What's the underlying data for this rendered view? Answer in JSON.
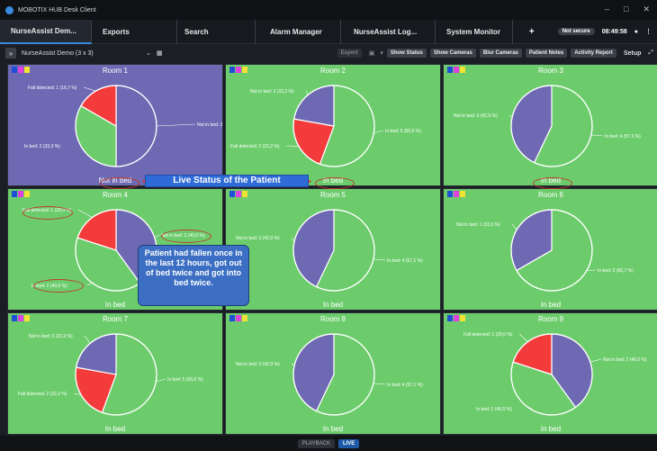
{
  "titlebar": {
    "title": "MOBOTIX HUB Desk Client"
  },
  "tabs": [
    {
      "label": "NurseAssist Dem..."
    },
    {
      "label": "Exports"
    },
    {
      "label": "Search"
    },
    {
      "label": "Alarm Manager"
    },
    {
      "label": "NurseAssist Log..."
    },
    {
      "label": "System Monitor"
    }
  ],
  "status": {
    "security": "Not secure",
    "clock": "08:49:58",
    "plus": "+"
  },
  "toolbar": {
    "view": "NurseAssist Demo (3 x 3)",
    "export": "Export",
    "show_status": "Show Status",
    "show_cameras": "Show Cameras",
    "blur_cameras": "Blur Cameras",
    "patient_notes": "Patient Notes",
    "activity_report": "Activity Report",
    "setup": "Setup"
  },
  "colors": {
    "fall": "#f43b3b",
    "not_in_bed": "#6e69b3",
    "in_bed": "#6ccc6c"
  },
  "rooms": [
    {
      "title": "Room 1",
      "status": "Not in bed",
      "slices": [
        {
          "label": "Not in bed: 3 (50,0 %)",
          "value": 50,
          "cat": "not_in_bed"
        },
        {
          "label": "In bed: 2 (33,3 %)",
          "value": 33.3,
          "cat": "in_bed"
        },
        {
          "label": "Fall detected: 1 (16,7 %)",
          "value": 16.7,
          "cat": "fall"
        }
      ]
    },
    {
      "title": "Room 2",
      "status": "In bed",
      "slices": [
        {
          "label": "In bed: 5 (55,6 %)",
          "value": 55.6,
          "cat": "in_bed"
        },
        {
          "label": "Fall detected: 2 (22,2 %)",
          "value": 22.2,
          "cat": "fall"
        },
        {
          "label": "Not in bed: 2 (22,2 %)",
          "value": 22.2,
          "cat": "not_in_bed"
        }
      ]
    },
    {
      "title": "Room 3",
      "status": "In bed",
      "slices": [
        {
          "label": "In bed: 4 (57,1 %)",
          "value": 57.1,
          "cat": "in_bed"
        },
        {
          "label": "Not in bed: 3 (42,9 %)",
          "value": 42.9,
          "cat": "not_in_bed"
        }
      ]
    },
    {
      "title": "Room 4",
      "status": "In bed",
      "slices": [
        {
          "label": "Not in bed: 2 (40,0 %)",
          "value": 40,
          "cat": "not_in_bed"
        },
        {
          "label": "In bed: 2 (40,0 %)",
          "value": 40,
          "cat": "in_bed"
        },
        {
          "label": "Fall detected: 1 (20,0 %)",
          "value": 20,
          "cat": "fall"
        }
      ]
    },
    {
      "title": "Room 5",
      "status": "In bed",
      "slices": [
        {
          "label": "In bed: 4 (57,1 %)",
          "value": 57.1,
          "cat": "in_bed"
        },
        {
          "label": "Not in bed: 3 (42,9 %)",
          "value": 42.9,
          "cat": "not_in_bed"
        }
      ]
    },
    {
      "title": "Room 6",
      "status": "In bed",
      "slices": [
        {
          "label": "In bed: 2 (66,7 %)",
          "value": 66.7,
          "cat": "in_bed"
        },
        {
          "label": "Not in bed: 1 (33,3 %)",
          "value": 33.3,
          "cat": "not_in_bed"
        }
      ]
    },
    {
      "title": "Room 7",
      "status": "In bed",
      "slices": [
        {
          "label": "In bed: 5 (55,6 %)",
          "value": 55.6,
          "cat": "in_bed"
        },
        {
          "label": "Fall detected: 2 (22,2 %)",
          "value": 22.2,
          "cat": "fall"
        },
        {
          "label": "Not in bed: 2 (22,2 %)",
          "value": 22.2,
          "cat": "not_in_bed"
        }
      ]
    },
    {
      "title": "Room 8",
      "status": "In bed",
      "slices": [
        {
          "label": "In bed: 4 (57,1 %)",
          "value": 57.1,
          "cat": "in_bed"
        },
        {
          "label": "Not in bed: 3 (42,9 %)",
          "value": 42.9,
          "cat": "not_in_bed"
        }
      ]
    },
    {
      "title": "Room 9",
      "status": "In bed",
      "slices": [
        {
          "label": "Not in bed: 2 (40,0 %)",
          "value": 40,
          "cat": "not_in_bed"
        },
        {
          "label": "In bed: 2 (40,0 %)",
          "value": 40,
          "cat": "in_bed"
        },
        {
          "label": "Fall detected: 1 (20,0 %)",
          "value": 20,
          "cat": "fall"
        }
      ]
    }
  ],
  "annotations": {
    "live_status": "Live Status of the Patient",
    "summary": "Patient had fallen once in the last 12 hours, got out of bed twice and got into bed twice."
  },
  "footer": {
    "playback": "PLAYBACK",
    "live": "LIVE"
  },
  "swatch_colors": [
    "#1f4fd6",
    "#e040e0",
    "#f2e233"
  ]
}
